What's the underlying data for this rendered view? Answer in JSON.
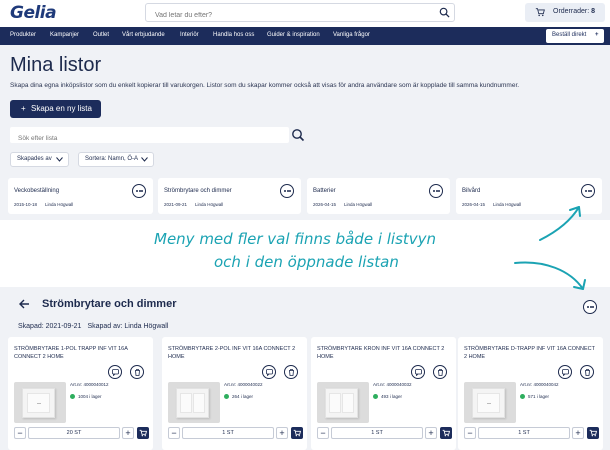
{
  "header": {
    "logo": "Gelia",
    "search_placeholder": "Vad letar du efter?",
    "orders_label": "Orderrader:",
    "orders_count": "8"
  },
  "nav": {
    "items": [
      "Produkter",
      "Kampanjer",
      "Outlet",
      "Vårt erbjudande",
      "Interiör",
      "Handla hos oss",
      "Guider & inspiration",
      "Vanliga frågor"
    ],
    "direct_label": "Beställ direkt",
    "direct_plus": "+"
  },
  "page": {
    "title": "Mina listor",
    "description": "Skapa dina egna inköpslistor som du enkelt kopierar till varukorgen. Listor som du skapar kommer också att visas för andra användare som är kopplade till samma kundnummer.",
    "create_button": "Skapa en ny lista",
    "create_plus": "+",
    "search_placeholder": "Sök efter lista",
    "filter_created": "Skapades av",
    "sort_label": "Sortera: Namn, Ö-A"
  },
  "lists": [
    {
      "name": "Veckobeställning",
      "date": "2015-10-18",
      "author": "Linda Högwall"
    },
    {
      "name": "Strömbrytare och dimmer",
      "date": "2021-09-21",
      "author": "Linda Högwall"
    },
    {
      "name": "Batterier",
      "date": "2026-04-15",
      "author": "Linda Högwall"
    },
    {
      "name": "Bilvård",
      "date": "2026-04-15",
      "author": "Linda Högwall"
    }
  ],
  "annotation": {
    "line1": "Meny med fler val finns både i listvyn",
    "line2": "och i den öppnade listan"
  },
  "opened_list": {
    "title": "Strömbrytare och dimmer",
    "created": "Skapad: 2021-09-21",
    "created_by": "Skapad av: Linda Högwall"
  },
  "products": [
    {
      "name": "STRÖMBRYTARE 1-POL TRAPP INF VIT 16A CONNECT 2 HOME",
      "art": "Art.nr: 4000040012",
      "stock": "1004 i lager",
      "qty": "20 ST",
      "minus": "−",
      "plus": "+"
    },
    {
      "name": "STRÖMBRYTARE 2-POL INF VIT 16A CONNECT 2 HOME",
      "art": "Art.nr: 4000040022",
      "stock": "264 i lager",
      "qty": "1 ST",
      "minus": "−",
      "plus": "+"
    },
    {
      "name": "STRÖMBRYTARE KRON INF VIT 16A CONNECT 2 HOME",
      "art": "Art.nr: 4000040032",
      "stock": "493 i lager",
      "qty": "1 ST",
      "minus": "−",
      "plus": "+"
    },
    {
      "name": "STRÖMBRYTARE D-TRAPP INF VIT 16A CONNECT 2 HOME",
      "art": "Art.nr: 4000040042",
      "stock": "571 i lager",
      "qty": "1 ST",
      "minus": "−",
      "plus": "+"
    }
  ],
  "colors": {
    "navy": "#1c2c5b",
    "accent": "#1ba3b3",
    "in_stock": "#2eae5e",
    "background": "#f0f2f6"
  }
}
